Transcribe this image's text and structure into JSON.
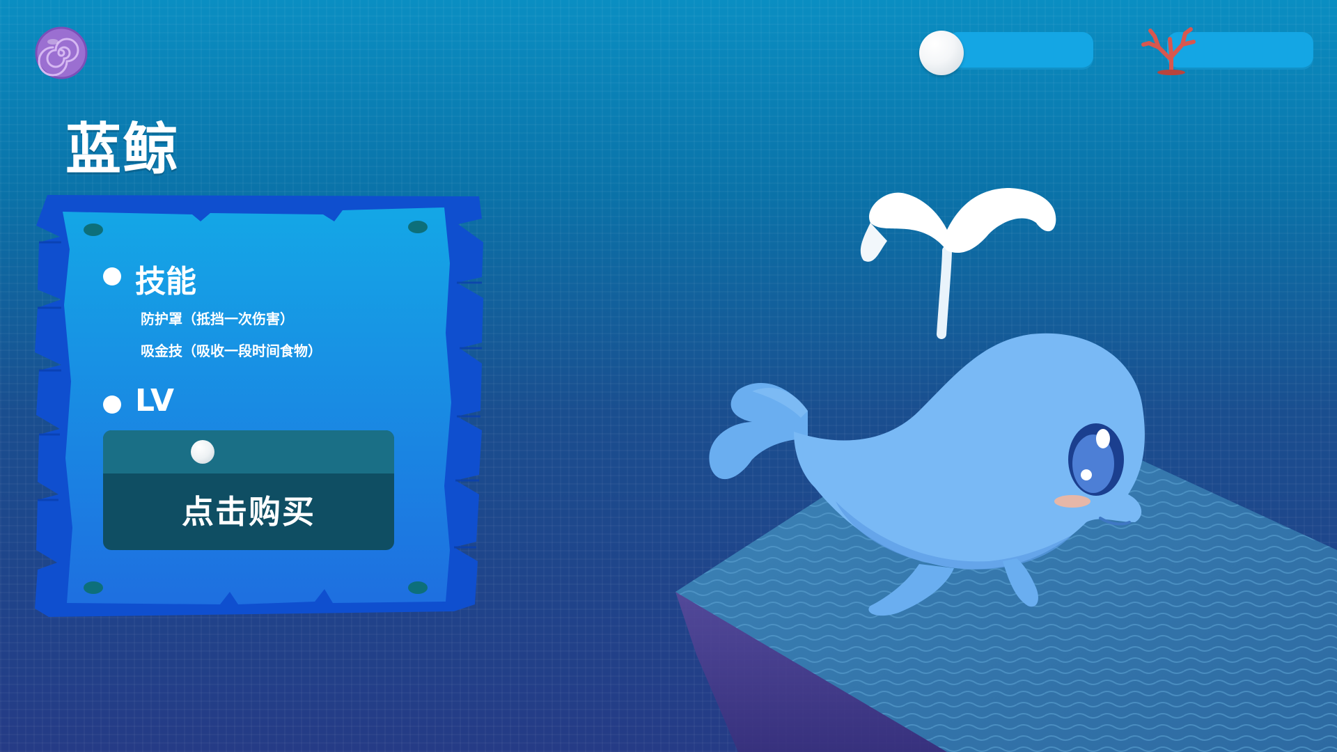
{
  "header": {
    "shell_icon": "purple-spiral-shell-icon",
    "pearl_count": "",
    "coral_count": ""
  },
  "title": "蓝鲸",
  "board": {
    "skills": {
      "title": "技能",
      "items": [
        "防护罩（抵挡一次伤害）",
        "吸金技（吸收一段时间食物）"
      ]
    },
    "level": {
      "title": "LV",
      "value": ""
    },
    "purchase": {
      "price": "",
      "button_label": "点击购买"
    }
  },
  "colors": {
    "background_top": "#0a8ec2",
    "background_bottom": "#253b86",
    "board": "#1a8fe0",
    "board_edge": "#0d52c8",
    "buy_box": "#0f4e63",
    "price_row": "#1a6f86",
    "currency_bar": "#14a6e4",
    "whale_body": "#79b9f5",
    "whale_belly": "#5d9de6"
  }
}
